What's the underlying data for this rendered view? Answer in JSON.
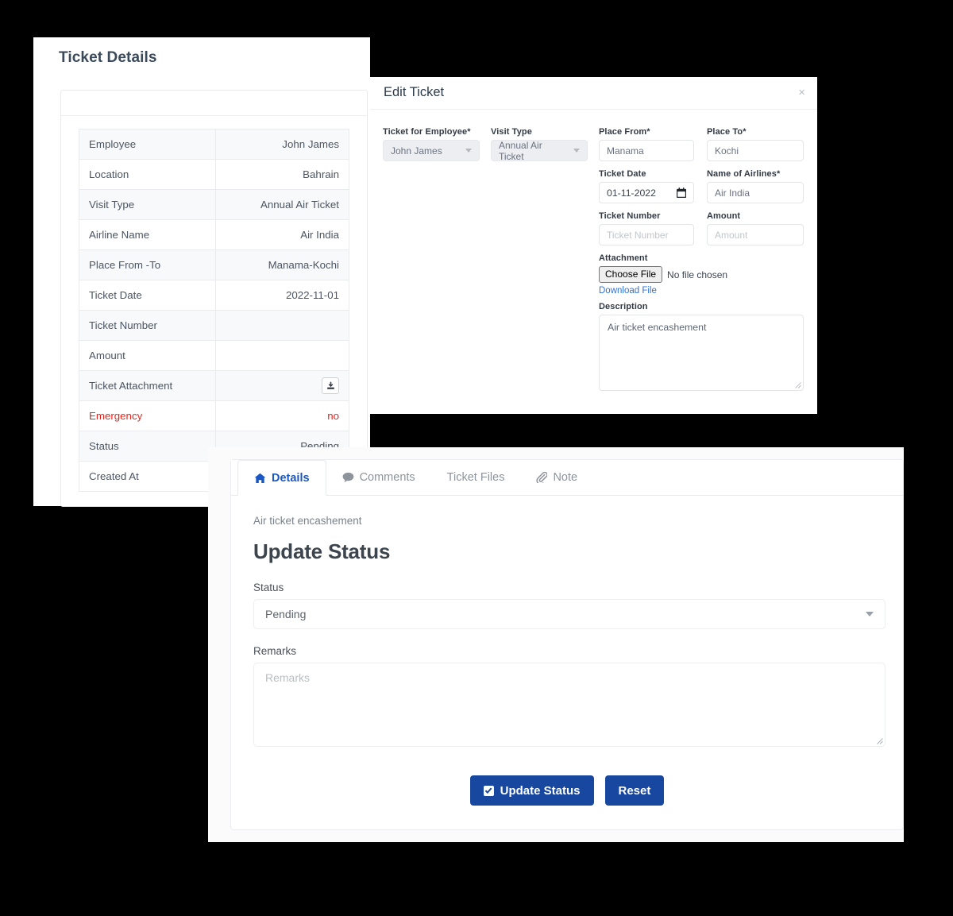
{
  "details_card": {
    "title": "Ticket Details",
    "rows": [
      {
        "label": "Employee",
        "value": "John James"
      },
      {
        "label": "Location",
        "value": "Bahrain"
      },
      {
        "label": "Visit Type",
        "value": "Annual Air Ticket"
      },
      {
        "label": "Airline Name",
        "value": "Air India"
      },
      {
        "label": "Place From -To",
        "value": "Manama-Kochi"
      },
      {
        "label": "Ticket Date",
        "value": "2022-11-01"
      },
      {
        "label": "Ticket Number",
        "value": ""
      },
      {
        "label": "Amount",
        "value": ""
      },
      {
        "label": "Ticket Attachment",
        "value": "",
        "icon": "download-icon"
      },
      {
        "label": "Emergency",
        "value": "no",
        "emphasis": "danger"
      },
      {
        "label": "Status",
        "value": "Pending"
      },
      {
        "label": "Created At",
        "value": ""
      }
    ]
  },
  "edit_modal": {
    "title": "Edit Ticket",
    "close_label": "×",
    "fields": {
      "employee": {
        "label": "Ticket for Employee*",
        "value": "John James",
        "disabled": true
      },
      "visit_type": {
        "label": "Visit Type",
        "value": "Annual Air Ticket",
        "disabled": true
      },
      "place_from": {
        "label": "Place From*",
        "value": "Manama"
      },
      "place_to": {
        "label": "Place To*",
        "value": "Kochi"
      },
      "ticket_date": {
        "label": "Ticket Date",
        "value": "01-11-2022"
      },
      "airline": {
        "label": "Name of Airlines*",
        "value": "Air India"
      },
      "ticket_number": {
        "label": "Ticket Number",
        "value": "",
        "placeholder": "Ticket Number"
      },
      "amount": {
        "label": "Amount",
        "value": "",
        "placeholder": "Amount"
      },
      "attachment": {
        "label": "Attachment",
        "button": "Choose File",
        "status": "No file chosen",
        "link": "Download File"
      },
      "description": {
        "label": "Description",
        "value": "Air ticket encashement"
      }
    }
  },
  "bottom_panel": {
    "tabs": [
      {
        "label": "Details",
        "icon": "home-icon",
        "active": true
      },
      {
        "label": "Comments",
        "icon": "comment-icon",
        "active": false
      },
      {
        "label": "Ticket Files",
        "icon": "",
        "active": false
      },
      {
        "label": "Note",
        "icon": "paperclip-icon",
        "active": false
      }
    ],
    "subtitle": "Air ticket encashement",
    "heading": "Update Status",
    "status": {
      "label": "Status",
      "value": "Pending"
    },
    "remarks": {
      "label": "Remarks",
      "value": "",
      "placeholder": "Remarks"
    },
    "buttons": {
      "update": "Update Status",
      "reset": "Reset"
    }
  },
  "colors": {
    "primary_blue": "#17479e",
    "tab_active_blue": "#1957c4",
    "danger_red": "#e8231a",
    "link_blue": "#2c72d8"
  }
}
